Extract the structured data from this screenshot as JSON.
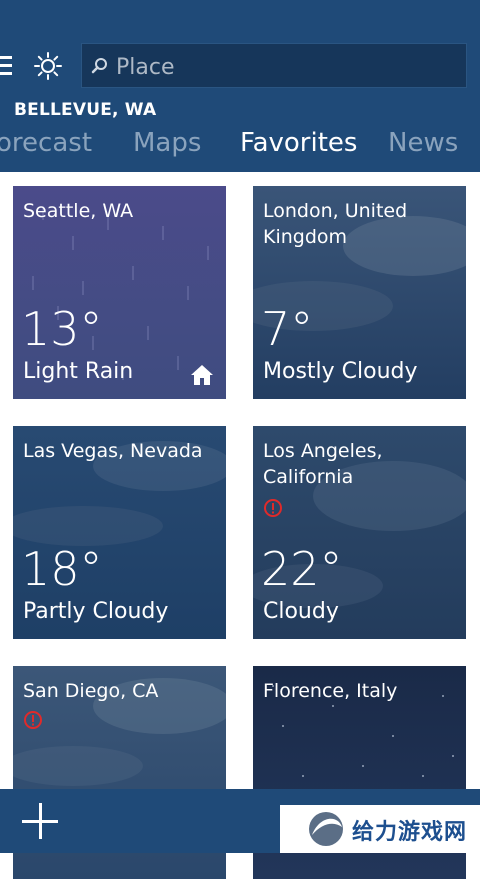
{
  "header": {
    "search_placeholder": "Place",
    "location": "BELLEVUE, WA",
    "tabs": [
      {
        "label": "Forecast"
      },
      {
        "label": "Maps"
      },
      {
        "label": "Favorites",
        "active": true
      },
      {
        "label": "News"
      }
    ]
  },
  "favorites": [
    {
      "name": "Seattle, WA",
      "temp": "13°",
      "condition": "Light Rain",
      "icon": "home-icon"
    },
    {
      "name": "London, United Kingdom",
      "temp": "7°",
      "condition": "Mostly Cloudy"
    },
    {
      "name": "Las Vegas, Nevada",
      "temp": "18°",
      "condition": "Partly Cloudy"
    },
    {
      "name": "Los Angeles, California",
      "temp": "22°",
      "condition": "Cloudy",
      "icon": "alert-icon"
    },
    {
      "name": "San Diego, CA",
      "temp": "",
      "condition": "",
      "icon": "alert-icon"
    },
    {
      "name": "Florence, Italy",
      "temp": "",
      "condition": ""
    }
  ],
  "appbar": {
    "add_icon": "plus-icon"
  },
  "watermark": {
    "text": "给力游戏网"
  },
  "colors": {
    "header_bg": "#1f4a78",
    "tab_inactive": "#8aa3bd",
    "alert": "#e02a2a",
    "tile_rain": "#4a4a86",
    "tile_cloud": "#27466e"
  }
}
